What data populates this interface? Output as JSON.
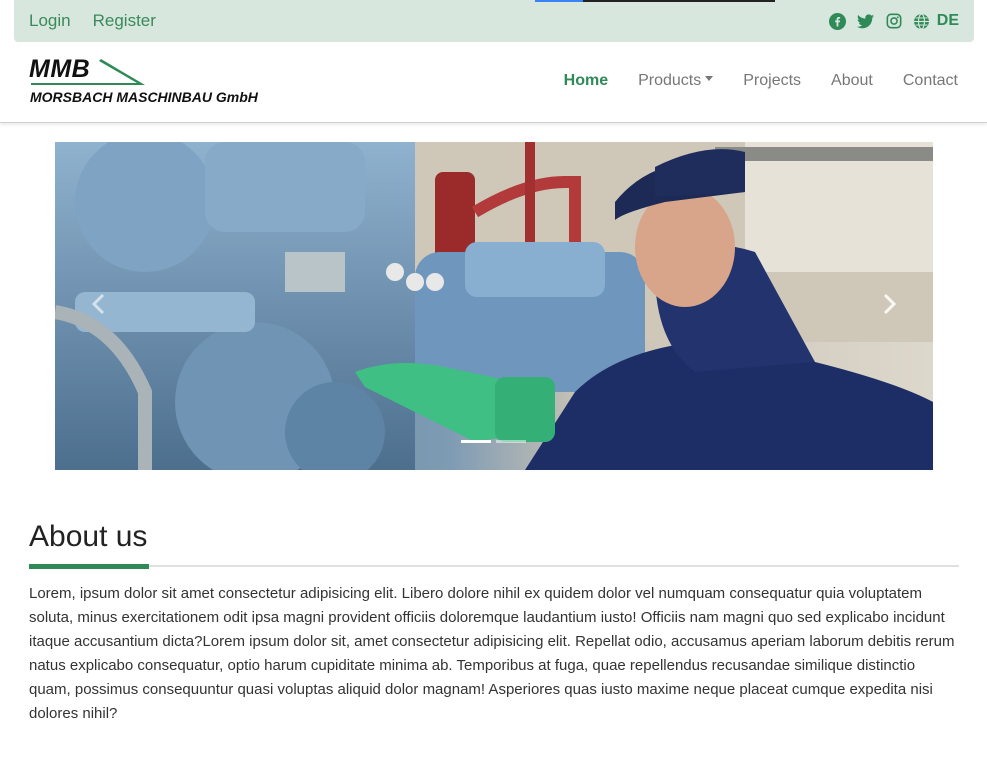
{
  "topbar": {
    "login_label": "Login",
    "register_label": "Register",
    "social_icons": [
      "facebook-icon",
      "twitter-icon",
      "instagram-icon",
      "globe-icon"
    ],
    "language_label": "DE",
    "accent_color": "#2f8a58",
    "background_color": "#d7e7dd"
  },
  "header": {
    "logo": {
      "short": "MMB",
      "company": "MORSBACH MASCHINBAU GmbH"
    },
    "nav": {
      "home": "Home",
      "products": "Products",
      "projects": "Projects",
      "about": "About",
      "contact": "Contact"
    }
  },
  "carousel": {
    "slide_count": 2,
    "active_slide": 1,
    "prev_icon": "chevron-left-icon",
    "next_icon": "chevron-right-icon"
  },
  "about": {
    "title": "About us",
    "body": "Lorem, ipsum dolor sit amet consectetur adipisicing elit. Libero dolore nihil ex quidem dolor vel numquam consequatur quia voluptatem soluta, minus exercitationem odit ipsa magni provident officiis doloremque laudantium iusto! Officiis nam magni quo sed explicabo incidunt itaque accusantium dicta?Lorem ipsum dolor sit, amet consectetur adipisicing elit. Repellat odio, accusamus aperiam laborum debitis rerum natus explicabo consequatur, optio harum cupiditate minima ab. Temporibus at fuga, quae repellendus recusandae similique distinctio quam, possimus consequuntur quasi voluptas aliquid dolor magnam! Asperiores quas iusto maxime neque placeat cumque expedita nisi dolores nihil?"
  }
}
